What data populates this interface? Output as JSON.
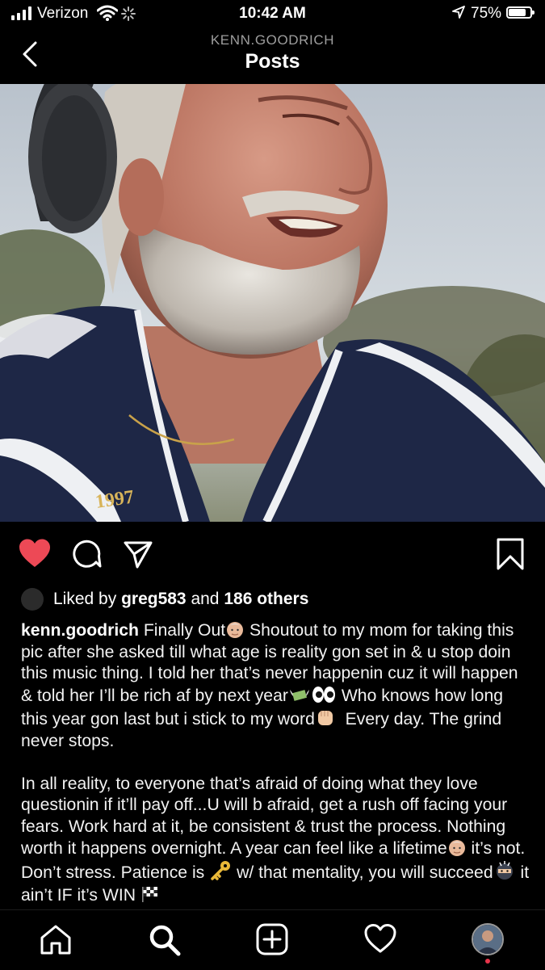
{
  "status_bar": {
    "carrier": "Verizon",
    "time": "10:42 AM",
    "battery_percent": "75%",
    "battery_level": 0.75
  },
  "header": {
    "username": "KENN.GOODRICH",
    "title": "Posts"
  },
  "post": {
    "photo_necklace_text": "1997",
    "liked_by_prefix": "Liked by",
    "liked_by_user": "greg583",
    "liked_by_joiner": "and",
    "liked_by_others": "186 others",
    "caption_user": "kenn.goodrich",
    "caption_p1_a": "Finally Out",
    "caption_p1_b": "Shoutout to my mom for taking this pic after she asked till what age is reality gon set in & u stop doin this music thing. I told her that’s never happenin cuz it will happen & told her I’ll be rich af by next year",
    "caption_p1_c": "Who knows how long this year gon last but i stick to my word",
    "caption_p1_d": "Every day. The grind never stops.",
    "caption_p2_a": "In all reality, to everyone that’s afraid of doing what they love questionin if it’ll pay off...U will b afraid, get a rush off facing your fears. Work hard at it, be consistent & trust the process. Nothing worth it happens overnight. A year can feel like a lifetime",
    "caption_p2_b": "it’s not. Don’t stress. Patience is",
    "caption_p2_c": "w/ that mentality, you will succeed",
    "caption_p2_d": "it ain’t IF it’s WIN"
  },
  "icons": {
    "like": "heart-icon",
    "comment": "comment-icon",
    "share": "share-icon",
    "save": "bookmark-icon",
    "nav": [
      "home-icon",
      "search-icon",
      "add-post-icon",
      "activity-heart-icon",
      "profile-avatar"
    ]
  },
  "colors": {
    "like_red": "#ed4956",
    "notification_dot": "#e8344a",
    "background": "#000000"
  }
}
